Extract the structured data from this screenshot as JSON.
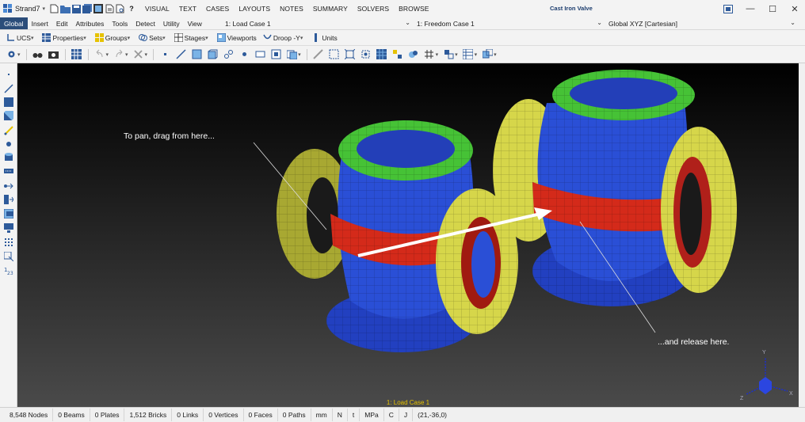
{
  "app": {
    "name": "Strand7",
    "document_title": "Cast Iron Valve",
    "menu_tabs": [
      "VISUAL",
      "TEXT",
      "CASES",
      "LAYOUTS",
      "NOTES",
      "SUMMARY",
      "SOLVERS",
      "BROWSE"
    ],
    "active_menu_tab": "VISUAL",
    "help_glyph": "?"
  },
  "ribbon": {
    "tabs": [
      "Global",
      "Insert",
      "Edit",
      "Attributes",
      "Tools",
      "Detect",
      "Utility",
      "View"
    ],
    "active_tab": "Global",
    "load_case": "1: Load Case 1",
    "freedom_case": "1: Freedom Case 1",
    "coord_system": "Global XYZ [Cartesian]"
  },
  "toolbar": {
    "ucs": "UCS",
    "properties": "Properties",
    "groups": "Groups",
    "sets": "Sets",
    "stages": "Stages",
    "viewports": "Viewports",
    "droop": "Droop -Y",
    "units": "Units"
  },
  "viewport": {
    "annotation_start": "To pan, drag from here...",
    "annotation_end": "...and release here.",
    "caption": "1: Load Case 1",
    "axis_labels": {
      "x": "X",
      "y": "Y",
      "z": "Z"
    }
  },
  "status": {
    "nodes": "8,548 Nodes",
    "beams": "0 Beams",
    "plates": "0 Plates",
    "bricks": "1,512 Bricks",
    "links": "0 Links",
    "vertices": "0 Vertices",
    "faces": "0 Faces",
    "paths": "0 Paths",
    "length_unit": "mm",
    "force_unit": "N",
    "temp_unit": "t",
    "stress_unit": "MPa",
    "temperature_unit": "C",
    "energy_unit": "J",
    "coords": "(21,-36,0)"
  },
  "colors": {
    "accent": "#2b4d7a",
    "model_blue": "#2a4fd6",
    "model_green": "#46c236",
    "model_red": "#d42a1a",
    "model_yellow": "#d6d64a",
    "caption_yellow": "#e6c200"
  }
}
